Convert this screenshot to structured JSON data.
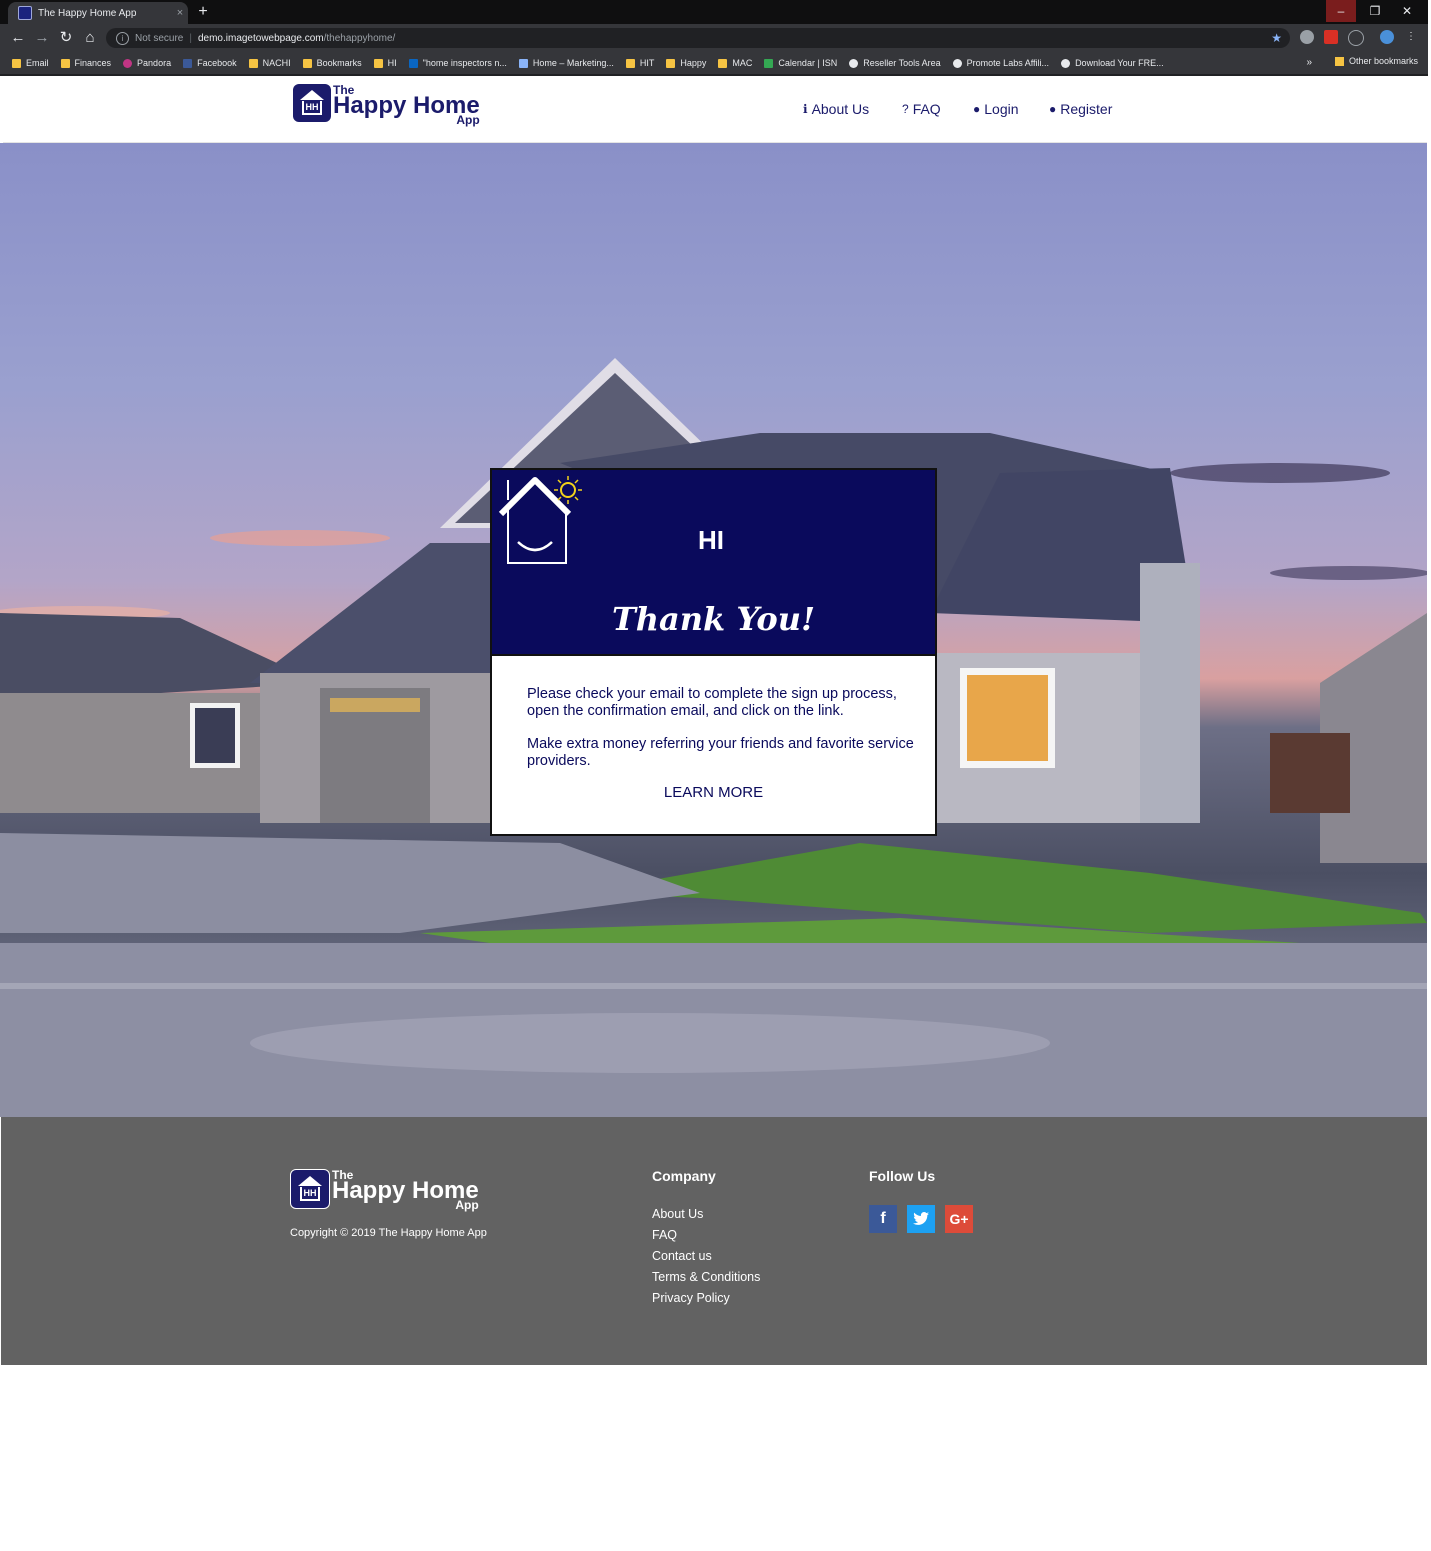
{
  "browser": {
    "tab_title": "The Happy Home App",
    "tab_close": "×",
    "new_tab": "+",
    "window_controls": [
      "–",
      "❐",
      "✕"
    ],
    "security_text": "Not secure",
    "url_host": "demo.imagetowebpage.com",
    "url_path": "/thehappyhome/",
    "bookmarks": [
      "Email",
      "Finances",
      "Pandora",
      "Facebook",
      "NACHI",
      "Bookmarks",
      "HI",
      "\"home inspectors n...",
      "Home – Marketing...",
      "HIT",
      "Happy",
      "MAC",
      "Calendar | ISN",
      "Reseller Tools Area",
      "Promote Labs Affili...",
      "Download Your FRE..."
    ],
    "bookmarks_overflow": "»",
    "other_bookmarks": "Other bookmarks"
  },
  "logo": {
    "the": "The",
    "main": "Happy Home",
    "app": "App"
  },
  "nav": {
    "about": "About Us",
    "faq": "FAQ",
    "login": "Login",
    "register": "Register"
  },
  "modal": {
    "logo_text": "HI",
    "title": "Thank You!",
    "paragraph1": "Please check your email to complete the sign up process, open the confirmation email, and click on the link.",
    "paragraph2": "Make extra money referring your friends and favorite service providers.",
    "learn_more": "LEARN MORE"
  },
  "footer": {
    "copyright": "Copyright © 2019 The Happy Home App",
    "company_title": "Company",
    "company_links": [
      "About Us",
      "FAQ",
      "Contact us",
      "Terms & Conditions",
      "Privacy Policy"
    ],
    "follow_title": "Follow Us",
    "social": [
      "f",
      "t",
      "G+"
    ]
  },
  "colors": {
    "brand_navy": "#0a0a5c",
    "footer_gray": "#626262"
  }
}
